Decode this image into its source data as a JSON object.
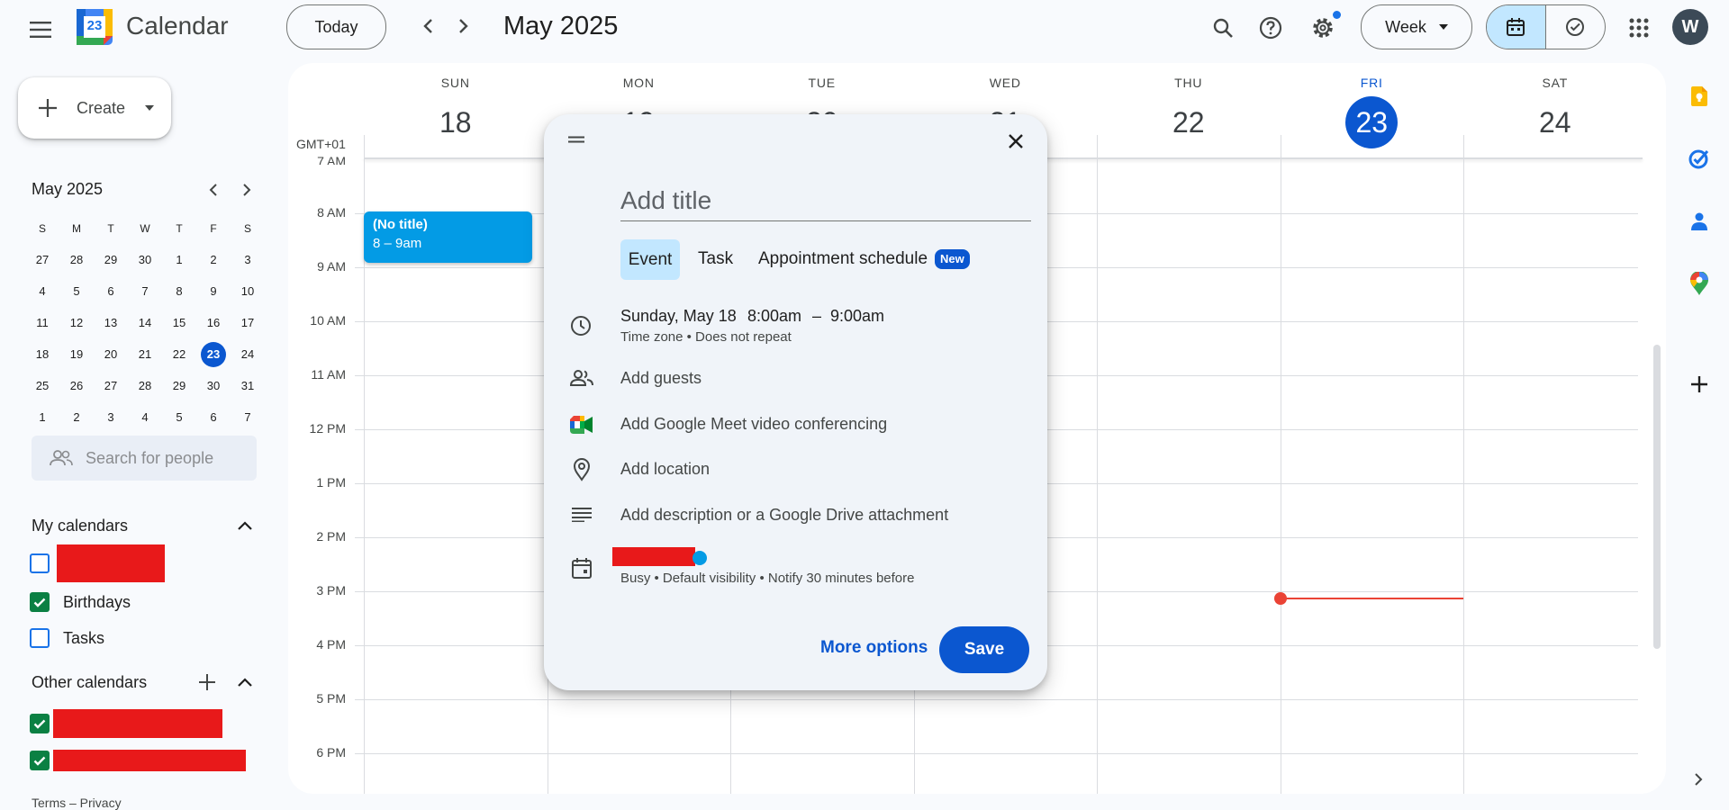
{
  "header": {
    "app_name": "Calendar",
    "logo_day": "23",
    "today_label": "Today",
    "current_range": "May 2025",
    "view_label": "Week",
    "avatar_letter": "W"
  },
  "sidebar": {
    "create_label": "Create",
    "mini_month": "May 2025",
    "weekday_headers": [
      "S",
      "M",
      "T",
      "W",
      "T",
      "F",
      "S"
    ],
    "weeks": [
      [
        "27",
        "28",
        "29",
        "30",
        "1",
        "2",
        "3"
      ],
      [
        "4",
        "5",
        "6",
        "7",
        "8",
        "9",
        "10"
      ],
      [
        "11",
        "12",
        "13",
        "14",
        "15",
        "16",
        "17"
      ],
      [
        "18",
        "19",
        "20",
        "21",
        "22",
        "23",
        "24"
      ],
      [
        "25",
        "26",
        "27",
        "28",
        "29",
        "30",
        "31"
      ],
      [
        "1",
        "2",
        "3",
        "4",
        "5",
        "6",
        "7"
      ]
    ],
    "today_day": "23",
    "search_people_placeholder": "Search for people",
    "my_calendars_title": "My calendars",
    "my_calendars": [
      {
        "label": "",
        "checked": false,
        "color": "#1a73e8"
      },
      {
        "label": "Birthdays",
        "checked": true,
        "color": "#0b8043"
      },
      {
        "label": "Tasks",
        "checked": false,
        "color": "#1a73e8"
      }
    ],
    "other_calendars_title": "Other calendars",
    "other_calendars": [
      {
        "label": "",
        "checked": true,
        "color": "#0b8043"
      },
      {
        "label": "",
        "checked": true,
        "color": "#0b8043"
      }
    ],
    "footer": "Terms – Privacy"
  },
  "week": {
    "timezone": "GMT+01",
    "days": [
      {
        "name": "SUN",
        "num": "18"
      },
      {
        "name": "MON",
        "num": "19"
      },
      {
        "name": "TUE",
        "num": "20"
      },
      {
        "name": "WED",
        "num": "21"
      },
      {
        "name": "THU",
        "num": "22"
      },
      {
        "name": "FRI",
        "num": "23",
        "today": true
      },
      {
        "name": "SAT",
        "num": "24"
      }
    ],
    "hours": [
      "7 AM",
      "8 AM",
      "9 AM",
      "10 AM",
      "11 AM",
      "12 PM",
      "1 PM",
      "2 PM",
      "3 PM",
      "4 PM",
      "5 PM",
      "6 PM"
    ]
  },
  "event": {
    "title": "(No title)",
    "time": "8 – 9am"
  },
  "dialog": {
    "title_placeholder": "Add title",
    "tabs": [
      "Event",
      "Task",
      "Appointment schedule"
    ],
    "new_badge": "New",
    "date": "Sunday, May 18",
    "start_time": "8:00am",
    "dash": "–",
    "end_time": "9:00am",
    "tz_repeat": "Time zone • Does not repeat",
    "add_guests": "Add guests",
    "add_meet": "Add Google Meet video conferencing",
    "add_location": "Add location",
    "add_description": "Add description or a Google Drive attachment",
    "calendar_details": "Busy • Default visibility • Notify 30 minutes before",
    "more_options": "More options",
    "save": "Save"
  },
  "colors": {
    "accent": "#0b57d0",
    "event": "#039be5",
    "now_line": "#ea4335",
    "redacted": "#e8191a"
  }
}
